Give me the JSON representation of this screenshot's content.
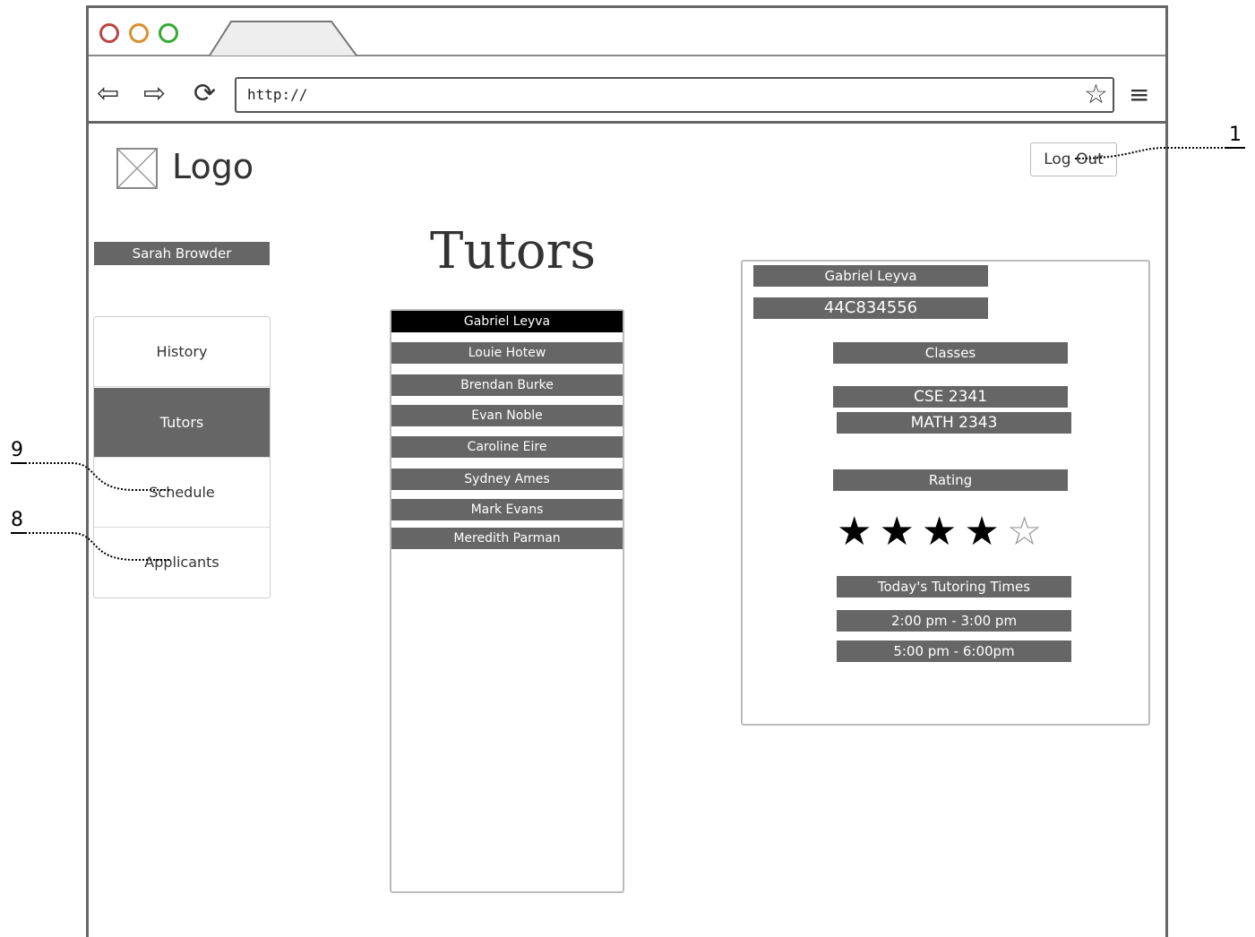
{
  "browser": {
    "url": "http://",
    "back_icon": "arrow-left-icon",
    "forward_icon": "arrow-right-icon",
    "reload_icon": "reload-icon",
    "bookmark_icon": "star-icon",
    "menu_icon": "hamburger-icon",
    "window_dots": [
      "#b44",
      "#d8902c",
      "#3a3"
    ]
  },
  "header": {
    "logo_text": "Logo",
    "logout_label": "Log Out"
  },
  "sidebar": {
    "user_name": "Sarah Browder",
    "items": [
      {
        "label": "History",
        "active": false
      },
      {
        "label": "Tutors",
        "active": true
      },
      {
        "label": "Schedule",
        "active": false
      },
      {
        "label": "Applicants",
        "active": false
      }
    ]
  },
  "main": {
    "title": "Tutors",
    "tutors": [
      {
        "name": "Gabriel Leyva",
        "selected": true
      },
      {
        "name": "Louie Hotew",
        "selected": false
      },
      {
        "name": "Brendan Burke",
        "selected": false
      },
      {
        "name": "Evan Noble",
        "selected": false
      },
      {
        "name": "Caroline Eire",
        "selected": false
      },
      {
        "name": "Sydney Ames",
        "selected": false
      },
      {
        "name": "Mark Evans",
        "selected": false
      },
      {
        "name": "Meredith Parman",
        "selected": false
      }
    ]
  },
  "detail": {
    "name": "Gabriel Leyva",
    "id": "44C834556",
    "classes_label": "Classes",
    "classes": [
      "CSE 2341",
      "MATH 2343"
    ],
    "rating_label": "Rating",
    "rating": 4,
    "rating_max": 5,
    "times_label": "Today's Tutoring Times",
    "times": [
      "2:00 pm - 3:00 pm",
      "5:00 pm - 6:00pm"
    ]
  },
  "annotations": [
    {
      "number": "1"
    },
    {
      "number": "9"
    },
    {
      "number": "8"
    }
  ]
}
